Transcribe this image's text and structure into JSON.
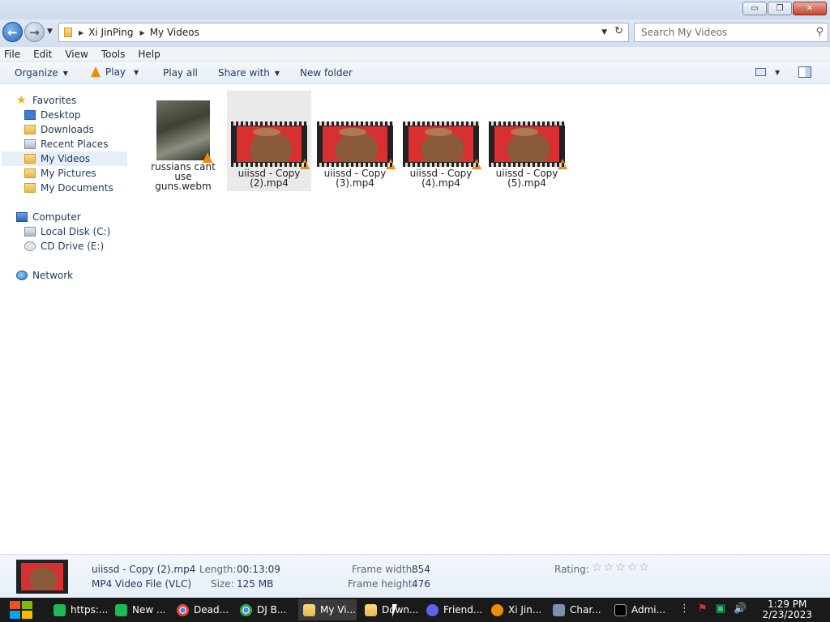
{
  "window": {
    "min_glyph": "▭",
    "max_glyph": "❐",
    "close_glyph": "✕"
  },
  "nav": {
    "back_glyph": "←",
    "forward_glyph": "→",
    "breadcrumb": [
      "Xi JinPing",
      "My Videos"
    ],
    "search_placeholder": "Search My Videos"
  },
  "menu": [
    "File",
    "Edit",
    "View",
    "Tools",
    "Help"
  ],
  "toolbar": {
    "organize": "Organize",
    "play": "Play",
    "play_all": "Play all",
    "share_with": "Share with",
    "new_folder": "New folder"
  },
  "sidebar": {
    "favorites_label": "Favorites",
    "favorites": [
      "Desktop",
      "Downloads",
      "Recent Places",
      "My Videos",
      "My Pictures",
      "My Documents"
    ],
    "computer_label": "Computer",
    "computer": [
      "Local Disk (C:)",
      "CD Drive (E:)"
    ],
    "network_label": "Network",
    "selected": "My Videos"
  },
  "files": [
    {
      "line1": "russians cant use",
      "line2": "guns.webm",
      "thumb": "photo"
    },
    {
      "line1": "uiissd - Copy",
      "line2": "(2).mp4",
      "thumb": "film",
      "selected": true
    },
    {
      "line1": "uiissd - Copy",
      "line2": "(3).mp4",
      "thumb": "film"
    },
    {
      "line1": "uiissd - Copy",
      "line2": "(4).mp4",
      "thumb": "film"
    },
    {
      "line1": "uiissd - Copy",
      "line2": "(5).mp4",
      "thumb": "film"
    }
  ],
  "details": {
    "name": "uiissd - Copy (2).mp4",
    "type": "MP4 Video File (VLC)",
    "length_label": "Length:",
    "length": "00:13:09",
    "size_label": "Size:",
    "size": "125 MB",
    "frame_width_label": "Frame width:",
    "frame_width": "854",
    "frame_height_label": "Frame height:",
    "frame_height": "476",
    "rating_label": "Rating:"
  },
  "taskbar": {
    "tasks": [
      {
        "label": "https:...",
        "color": "#1db954"
      },
      {
        "label": "New ...",
        "color": "#1db954"
      },
      {
        "label": "Dead...",
        "color": "#e0a800"
      },
      {
        "label": "DJ B...",
        "color": "#e0a800"
      },
      {
        "label": "My Vi...",
        "color": "#e8c35a"
      },
      {
        "label": "Down...",
        "color": "#e8c35a"
      },
      {
        "label": "Friend...",
        "color": "#5865f2"
      },
      {
        "label": "Xi Jin...",
        "color": "#f28a00"
      },
      {
        "label": "Char...",
        "color": "#7d8fb0"
      },
      {
        "label": "Admi...",
        "color": "#555555"
      }
    ],
    "time": "1:29 PM",
    "date": "2/23/2023"
  }
}
